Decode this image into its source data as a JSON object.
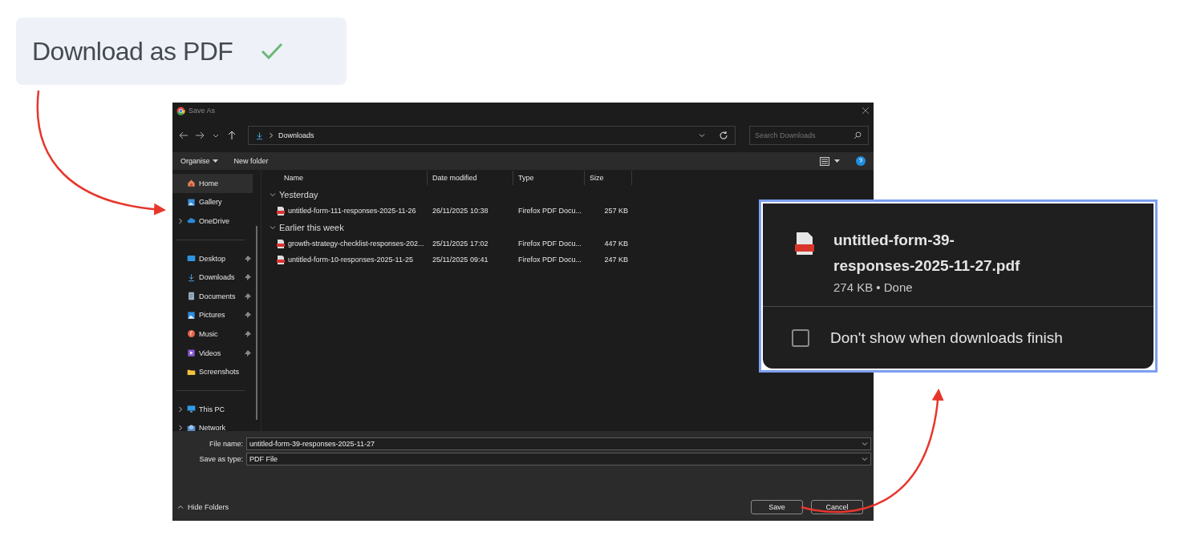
{
  "download_button": {
    "label": "Download as PDF",
    "done": true
  },
  "dialog": {
    "title": "Save As",
    "address": {
      "path": "Downloads"
    },
    "search": {
      "placeholder": "Search Downloads"
    },
    "toolbar": [
      {
        "label": "Organise",
        "kind": "menu"
      },
      {
        "label": "New folder",
        "kind": "button"
      }
    ],
    "sidebar": [
      [
        {
          "label": "Home",
          "kind": "home",
          "selected": true,
          "expandable": false,
          "pinned": false
        },
        {
          "label": "Gallery",
          "kind": "gallery",
          "selected": false,
          "expandable": false,
          "pinned": false
        },
        {
          "label": "OneDrive",
          "kind": "cloud",
          "selected": false,
          "expandable": true,
          "pinned": false
        }
      ],
      [
        {
          "label": "Desktop",
          "kind": "desktop",
          "selected": false,
          "expandable": false,
          "pinned": true
        },
        {
          "label": "Downloads",
          "kind": "download",
          "selected": false,
          "expandable": false,
          "pinned": true
        },
        {
          "label": "Documents",
          "kind": "document",
          "selected": false,
          "expandable": false,
          "pinned": true
        },
        {
          "label": "Pictures",
          "kind": "pictures",
          "selected": false,
          "expandable": false,
          "pinned": true
        },
        {
          "label": "Music",
          "kind": "music",
          "selected": false,
          "expandable": false,
          "pinned": true
        },
        {
          "label": "Videos",
          "kind": "video",
          "selected": false,
          "expandable": false,
          "pinned": true
        },
        {
          "label": "Screenshots",
          "kind": "folder",
          "selected": false,
          "expandable": false,
          "pinned": false
        }
      ],
      [
        {
          "label": "This PC",
          "kind": "pc",
          "selected": false,
          "expandable": true,
          "pinned": false
        },
        {
          "label": "Network",
          "kind": "network",
          "selected": false,
          "expandable": true,
          "pinned": false
        }
      ]
    ],
    "columns": [
      "Name",
      "Date modified",
      "Type",
      "Size"
    ],
    "groups": [
      {
        "label": "Yesterday",
        "expanded": true,
        "files": [
          {
            "name": "untitled-form-111-responses-2025-11-26",
            "date": "26/11/2025 10:38",
            "type": "Firefox PDF Docu...",
            "size": "257 KB"
          }
        ]
      },
      {
        "label": "Earlier this week",
        "expanded": true,
        "files": [
          {
            "name": "growth-strategy-checklist-responses-202...",
            "date": "25/11/2025 17:02",
            "type": "Firefox PDF Docu...",
            "size": "447 KB"
          },
          {
            "name": "untitled-form-10-responses-2025-11-25",
            "date": "25/11/2025 09:41",
            "type": "Firefox PDF Docu...",
            "size": "247 KB"
          }
        ]
      }
    ],
    "file_name": {
      "label": "File name:",
      "value": "untitled-form-39-responses-2025-11-27"
    },
    "save_as_type": {
      "label": "Save as type:",
      "value": "PDF File"
    },
    "hide_folders": "Hide Folders",
    "buttons": [
      "Save",
      "Cancel"
    ]
  },
  "download_popup": {
    "file_name": "untitled-form-39-responses-2025-11-27.pdf",
    "status": "274 KB • Done",
    "option": {
      "label": "Don't show when downloads finish",
      "checked": false
    }
  }
}
